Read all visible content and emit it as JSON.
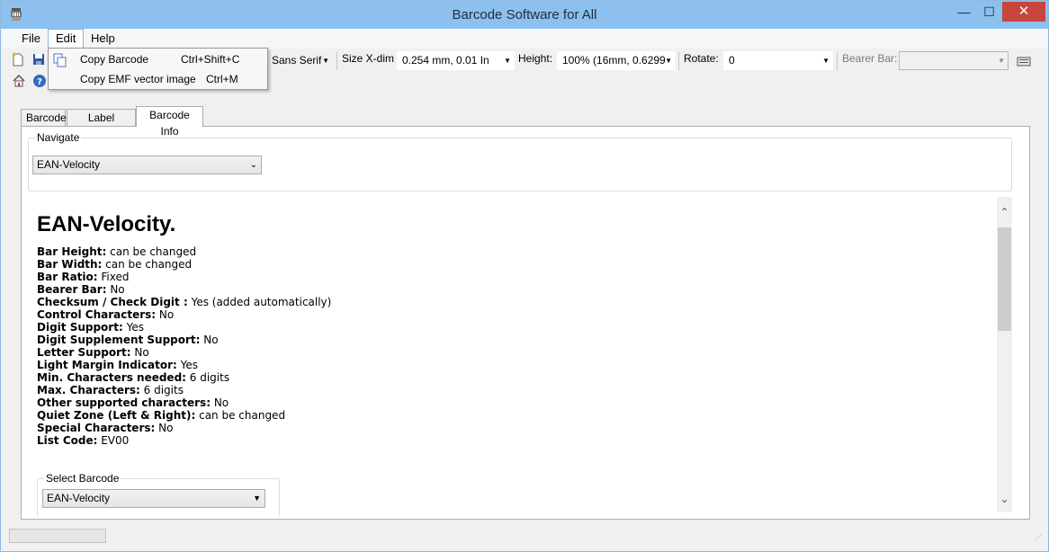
{
  "window": {
    "title": "Barcode Software for All",
    "controls": {
      "minimize": "—",
      "maximize": "☐",
      "close": "✕"
    }
  },
  "menubar": {
    "items": [
      "File",
      "Edit",
      "Help"
    ]
  },
  "edit_menu": {
    "items": [
      {
        "label": "Copy Barcode",
        "shortcut": "Ctrl+Shift+C"
      },
      {
        "label": "Copy EMF vector image",
        "shortcut": "Ctrl+M"
      }
    ]
  },
  "toolbar": {
    "font_value": "Sans Serif",
    "size_xdim_label": "Size X-dim",
    "size_xdim_value": "0.254 mm, 0.01 In",
    "height_label": "Height:",
    "height_value": "100% (16mm, 0.6299",
    "rotate_label": "Rotate:",
    "rotate_value": "0",
    "bearer_bar_label": "Bearer Bar:",
    "bearer_bar_value": ""
  },
  "tabs": [
    {
      "label": "Barcode",
      "active": false
    },
    {
      "label": "Label settings",
      "active": false
    },
    {
      "label": "Barcode Info",
      "active": true
    }
  ],
  "navigate": {
    "title": "Navigate",
    "selected": "EAN-Velocity"
  },
  "info": {
    "heading": "EAN-Velocity.",
    "properties": [
      {
        "key": "Bar Height:",
        "value": " can be changed"
      },
      {
        "key": "Bar Width:",
        "value": " can be changed"
      },
      {
        "key": "Bar Ratio:",
        "value": " Fixed"
      },
      {
        "key": "Bearer Bar:",
        "value": " No"
      },
      {
        "key": "Checksum / Check Digit :",
        "value": " Yes (added automatically)"
      },
      {
        "key": "Control Characters:",
        "value": " No"
      },
      {
        "key": "Digit Support:",
        "value": " Yes"
      },
      {
        "key": "Digit Supplement Support:",
        "value": " No"
      },
      {
        "key": "Letter Support:",
        "value": " No"
      },
      {
        "key": "Light Margin Indicator:",
        "value": " Yes"
      },
      {
        "key": "Min. Characters needed:",
        "value": " 6 digits"
      },
      {
        "key": "Max. Characters:",
        "value": " 6 digits"
      },
      {
        "key": "Other supported characters:",
        "value": " No"
      },
      {
        "key": "Quiet Zone (Left & Right):",
        "value": " can be changed"
      },
      {
        "key": "Special Characters:",
        "value": " No"
      },
      {
        "key": "List Code:",
        "value": " EV00"
      }
    ]
  },
  "select_barcode": {
    "title": "Select Barcode",
    "selected": "EAN-Velocity"
  },
  "icons": {
    "scroll_up": "⌃",
    "scroll_down": "⌄",
    "combo_arrow": "▼"
  },
  "colors": {
    "titlebar": "#8cc0ee",
    "close_button": "#c7463c"
  }
}
